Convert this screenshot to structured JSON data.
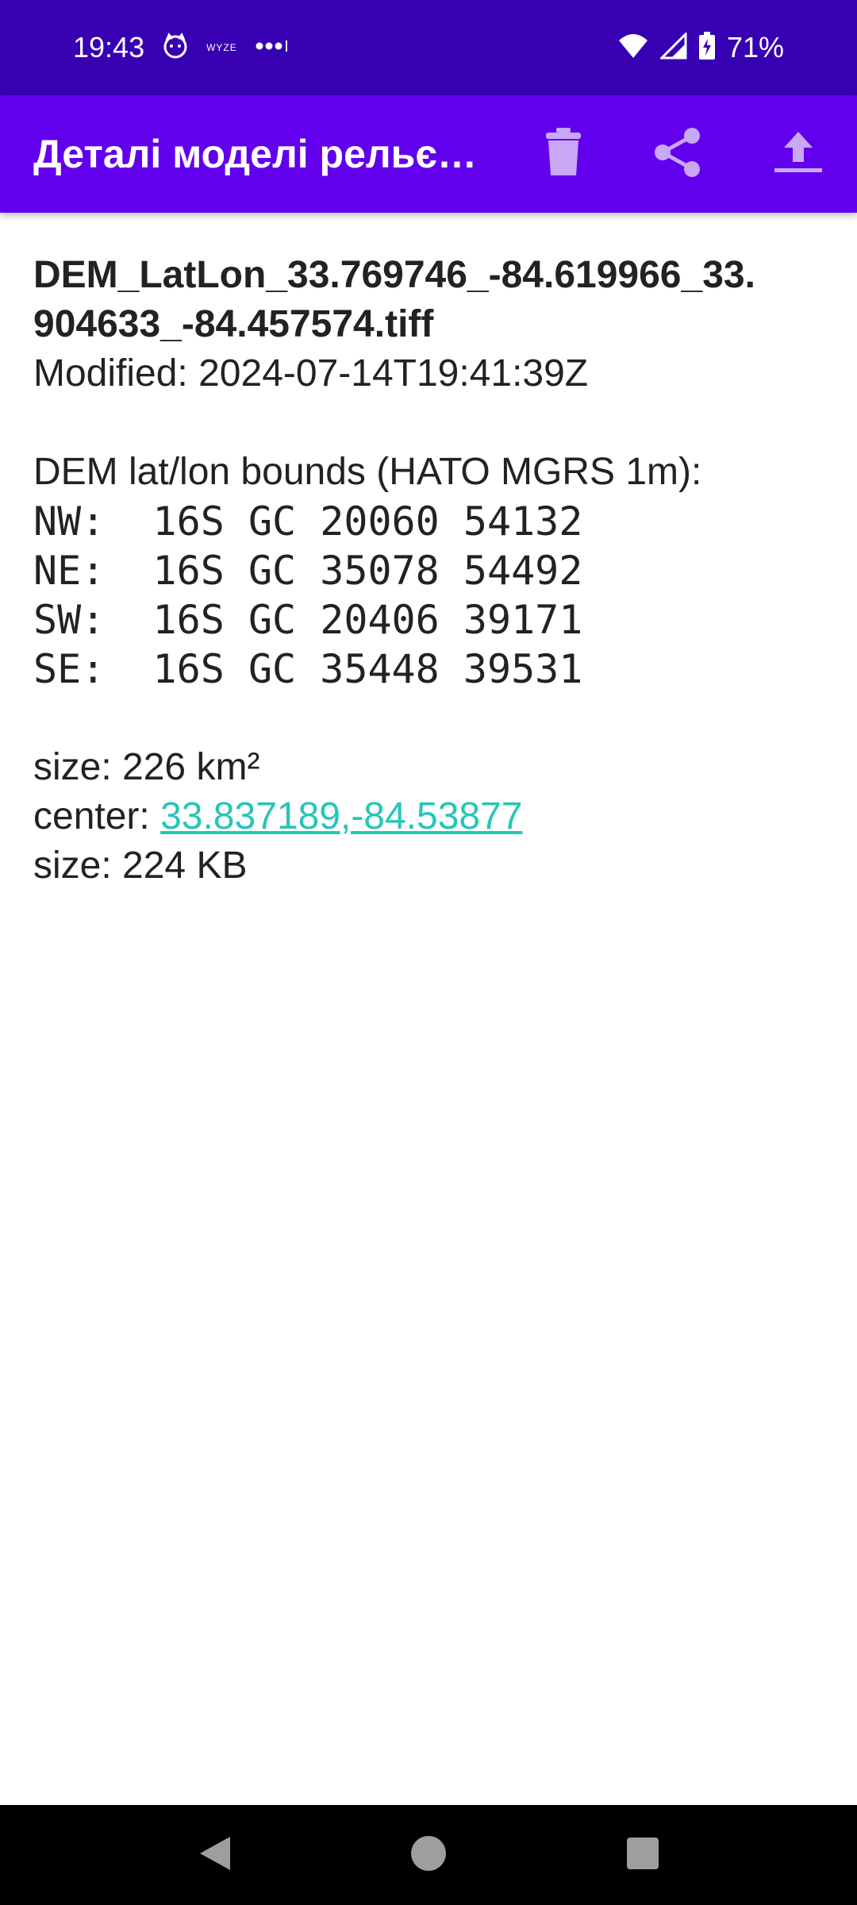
{
  "status_bar": {
    "time": "19:43",
    "notification_icons": [
      "cat-face-icon",
      "wyze-icon",
      "more-dots-icon"
    ],
    "wyze_label": "WYZE",
    "battery": "71%",
    "icons": [
      "wifi-icon",
      "cell-signal-icon",
      "battery-charging-icon"
    ]
  },
  "app_bar": {
    "title": "Деталі моделі рельє…",
    "actions": [
      "delete-icon",
      "share-icon",
      "upload-icon"
    ],
    "background": "#6200ee"
  },
  "details": {
    "filename_line1": "DEM_LatLon_33.769746_-84.619966_33.",
    "filename_line2": "904633_-84.457574.tiff",
    "modified": "Modified: 2024-07-14T19:41:39Z",
    "bounds_heading": "DEM lat/lon bounds (НАТО MGRS 1m):",
    "bounds": [
      {
        "label": "NW:",
        "value": "16S GC 20060 54132"
      },
      {
        "label": "NE:",
        "value": "16S GC 35078 54492"
      },
      {
        "label": "SW:",
        "value": "16S GC 20406 39171"
      },
      {
        "label": "SE:",
        "value": "16S GC 35448 39531"
      }
    ],
    "area": "size: 226 km²",
    "center_label": "center: ",
    "center_link": "33.837189,-84.53877",
    "file_size": "size: 224 KB",
    "link_color": "#26c6b8"
  },
  "nav_bar": {
    "buttons": [
      "back-icon",
      "home-icon",
      "recents-icon"
    ]
  }
}
